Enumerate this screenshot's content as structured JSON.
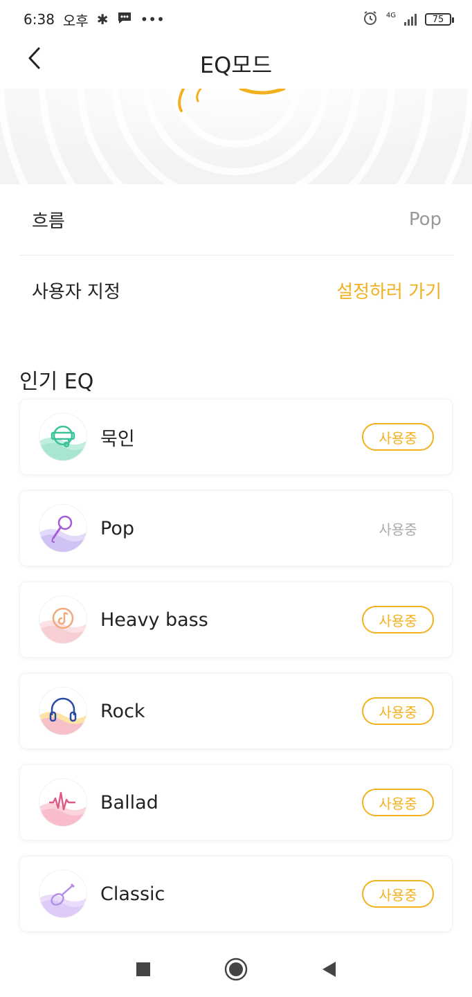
{
  "status_bar": {
    "time": "6:38",
    "ampm": "오후",
    "network": "4G",
    "battery": "75"
  },
  "header": {
    "title": "EQ모드"
  },
  "settings": [
    {
      "label": "흐름",
      "value": "Pop"
    },
    {
      "label": "사용자 지정",
      "value": "설정하러 가기"
    }
  ],
  "popular": {
    "title": "인기 EQ",
    "items": [
      {
        "name": "묵인",
        "button": "사용중",
        "active": false,
        "icon": "vinyl-icon",
        "color": "#3cc29a"
      },
      {
        "name": "Pop",
        "button": "사용중",
        "active": true,
        "icon": "microphone-icon",
        "color": "#a65ad6"
      },
      {
        "name": "Heavy bass",
        "button": "사용중",
        "active": false,
        "icon": "music-disc-icon",
        "color": "#f0a97a"
      },
      {
        "name": "Rock",
        "button": "사용중",
        "active": false,
        "icon": "headphones-icon",
        "color": "#2b4aa8"
      },
      {
        "name": "Ballad",
        "button": "사용중",
        "active": false,
        "icon": "waveform-icon",
        "color": "#e05a86"
      },
      {
        "name": "Classic",
        "button": "사용중",
        "active": false,
        "icon": "guitar-icon",
        "color": "#b690e6"
      }
    ]
  },
  "colors": {
    "accent": "#f2b01e",
    "muted": "#999999"
  }
}
